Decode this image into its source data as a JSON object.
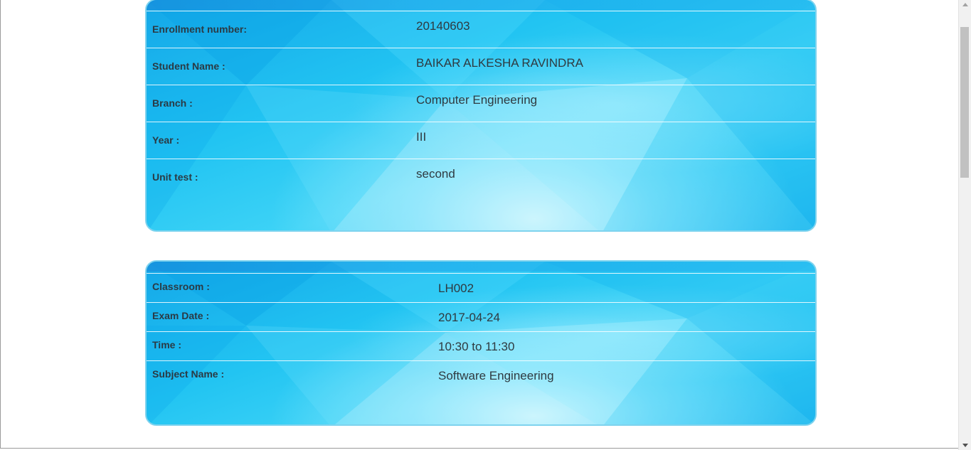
{
  "student_info": {
    "rows": [
      {
        "label": "Enrollment number:",
        "value": "20140603"
      },
      {
        "label": "Student Name :",
        "value": "BAIKAR ALKESHA RAVINDRA"
      },
      {
        "label": "Branch :",
        "value": "Computer Engineering"
      },
      {
        "label": "Year :",
        "value": "III"
      },
      {
        "label": "Unit test :",
        "value": "second"
      }
    ]
  },
  "exam_info": {
    "rows": [
      {
        "label": "Classroom :",
        "value": "LH002"
      },
      {
        "label": "Exam Date :",
        "value": "2017-04-24"
      },
      {
        "label": "Time :",
        "value": "10:30 to 11:30"
      },
      {
        "label": "Subject Name :",
        "value": "Software Engineering"
      }
    ]
  },
  "scrollbar": {
    "position_fraction": 0.0
  },
  "colors": {
    "card_border": "#7fd3ee",
    "card_base": "#22c4f2",
    "text": "#2b3a44"
  }
}
